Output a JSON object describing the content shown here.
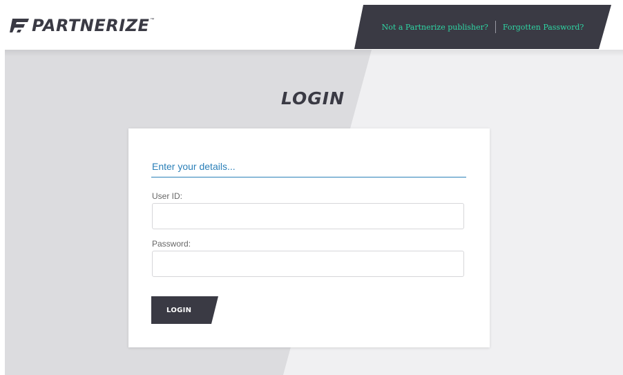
{
  "brand": {
    "name": "PARTNERIZE",
    "trademark": "™",
    "color": "#3a3a44",
    "accent": "#2ed7a4"
  },
  "topbar": {
    "links": [
      {
        "label": "Not a Partnerize publisher?"
      },
      {
        "label": "Forgotten Password?"
      }
    ]
  },
  "login": {
    "title": "LOGIN",
    "subtitle": "Enter your details...",
    "user_id_label": "User ID:",
    "user_id_value": "",
    "password_label": "Password:",
    "password_value": "",
    "button_label": "LOGIN"
  },
  "colors": {
    "primary_link": "#2a7fb8",
    "dark": "#3a3a44",
    "background_light": "#f0f0f2",
    "background_shade": "#dcdcdf"
  }
}
